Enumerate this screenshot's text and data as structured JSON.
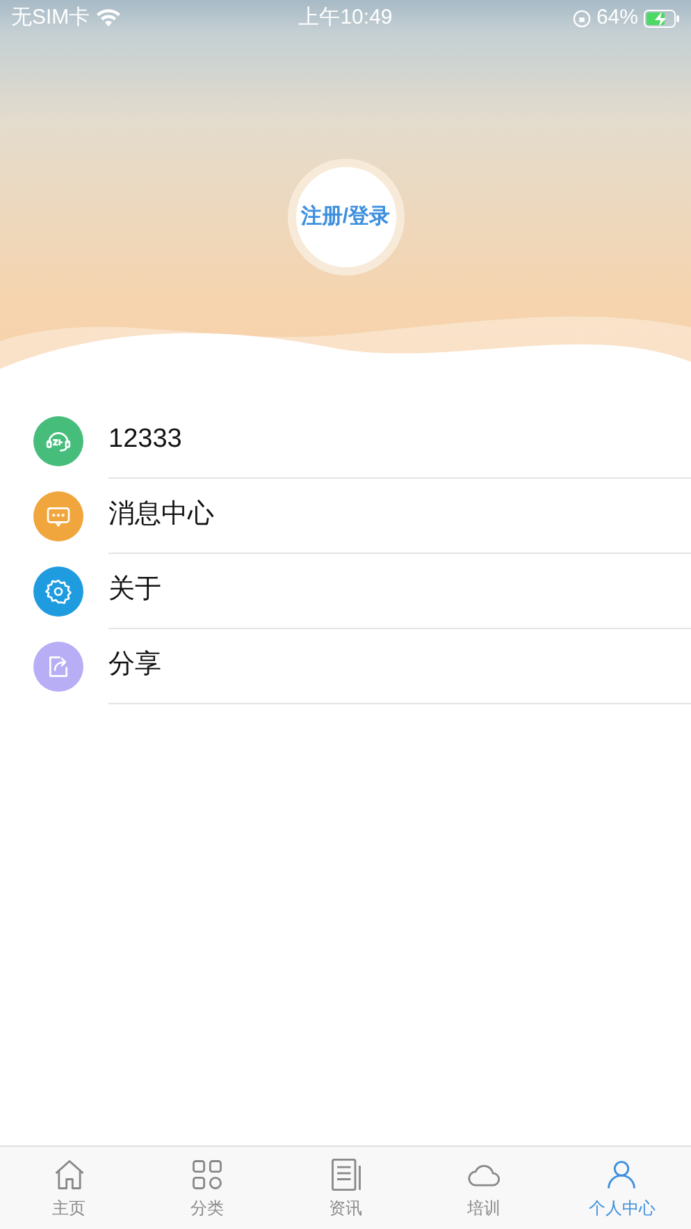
{
  "status_bar": {
    "carrier": "无SIM卡",
    "time": "上午10:49",
    "battery": "64%"
  },
  "profile": {
    "login_button": "注册/登录"
  },
  "menu": [
    {
      "kind": "hotline",
      "label": "12333",
      "color": "#47bd7c"
    },
    {
      "kind": "messages",
      "label": "消息中心",
      "color": "#f0a63c"
    },
    {
      "kind": "about",
      "label": "关于",
      "color": "#1f9ce0"
    },
    {
      "kind": "share",
      "label": "分享",
      "color": "#b7aef5"
    }
  ],
  "tab_bar": [
    {
      "kind": "home",
      "label": "主页",
      "selected": false
    },
    {
      "kind": "category",
      "label": "分类",
      "selected": false
    },
    {
      "kind": "news",
      "label": "资讯",
      "selected": false
    },
    {
      "kind": "training",
      "label": "培训",
      "selected": false
    },
    {
      "kind": "profile",
      "label": "个人中心",
      "selected": true
    }
  ]
}
